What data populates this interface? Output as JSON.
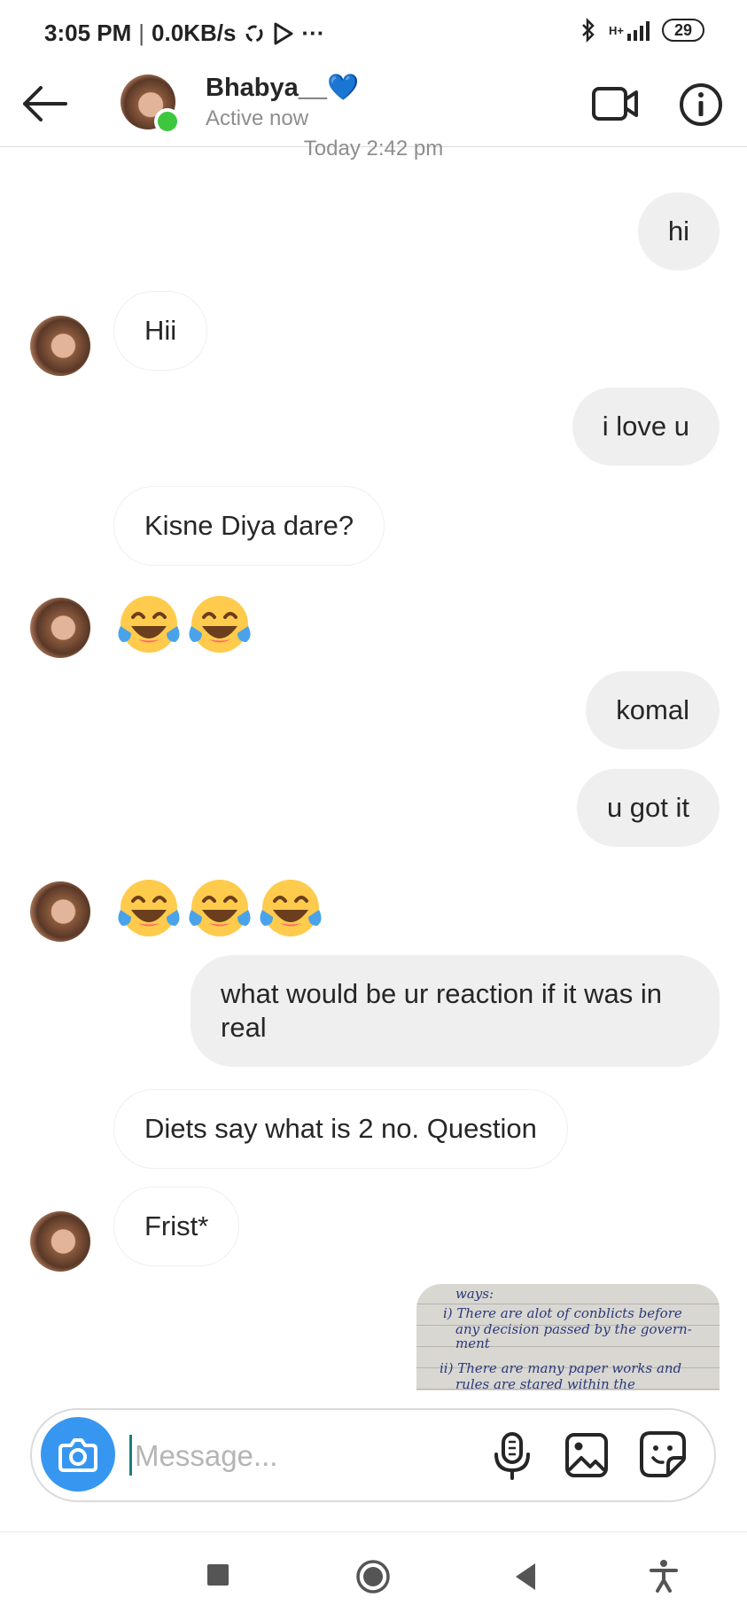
{
  "status_bar": {
    "time": "3:05 PM",
    "network_speed": "0.0KB/s",
    "more": "···",
    "battery": "29",
    "net_type": "H+"
  },
  "header": {
    "username": "Bhabya__",
    "heart_emoji": "💙",
    "status": "Active now",
    "icons": [
      "back-arrow-icon",
      "video-call-icon",
      "info-icon"
    ]
  },
  "conversation": {
    "timestamp": "Today 2:42 pm",
    "messages": [
      {
        "from": "me",
        "text": "hi"
      },
      {
        "from": "them",
        "text": "Hii"
      },
      {
        "from": "me",
        "text": "i love u"
      },
      {
        "from": "them",
        "text": "Kisne Diya dare?"
      },
      {
        "from": "them",
        "emoji_count": 2,
        "emoji": "face-with-tears-of-joy"
      },
      {
        "from": "me",
        "text": "komal"
      },
      {
        "from": "me",
        "text": "u got it"
      },
      {
        "from": "them",
        "emoji_count": 3,
        "emoji": "face-with-tears-of-joy"
      },
      {
        "from": "me",
        "text": "what would be ur reaction if it was in real"
      },
      {
        "from": "them",
        "text": "Diets say what is 2 no. Question"
      },
      {
        "from": "them",
        "text": "Frist*"
      },
      {
        "from": "me",
        "type": "photo"
      }
    ],
    "photo_text": {
      "line1": "ways:",
      "line2": "i) There are alot of conblicts before",
      "line3": "any decision passed by the govern-",
      "line4": "ment",
      "line5": "ii) There are many paper works and",
      "line6": "rules are stared within the"
    }
  },
  "composer": {
    "placeholder": "Message...",
    "icons": [
      "camera-icon",
      "microphone-icon",
      "gallery-icon",
      "sticker-icon"
    ]
  },
  "nav_bar": {
    "icons": [
      "recents-square-icon",
      "home-circle-icon",
      "back-triangle-icon",
      "accessibility-icon"
    ]
  },
  "colors": {
    "accent_blue": "#3797f0",
    "online_green": "#3ec63e",
    "outgoing_bubble": "#efefef",
    "secondary_text": "#8e8e8e"
  }
}
